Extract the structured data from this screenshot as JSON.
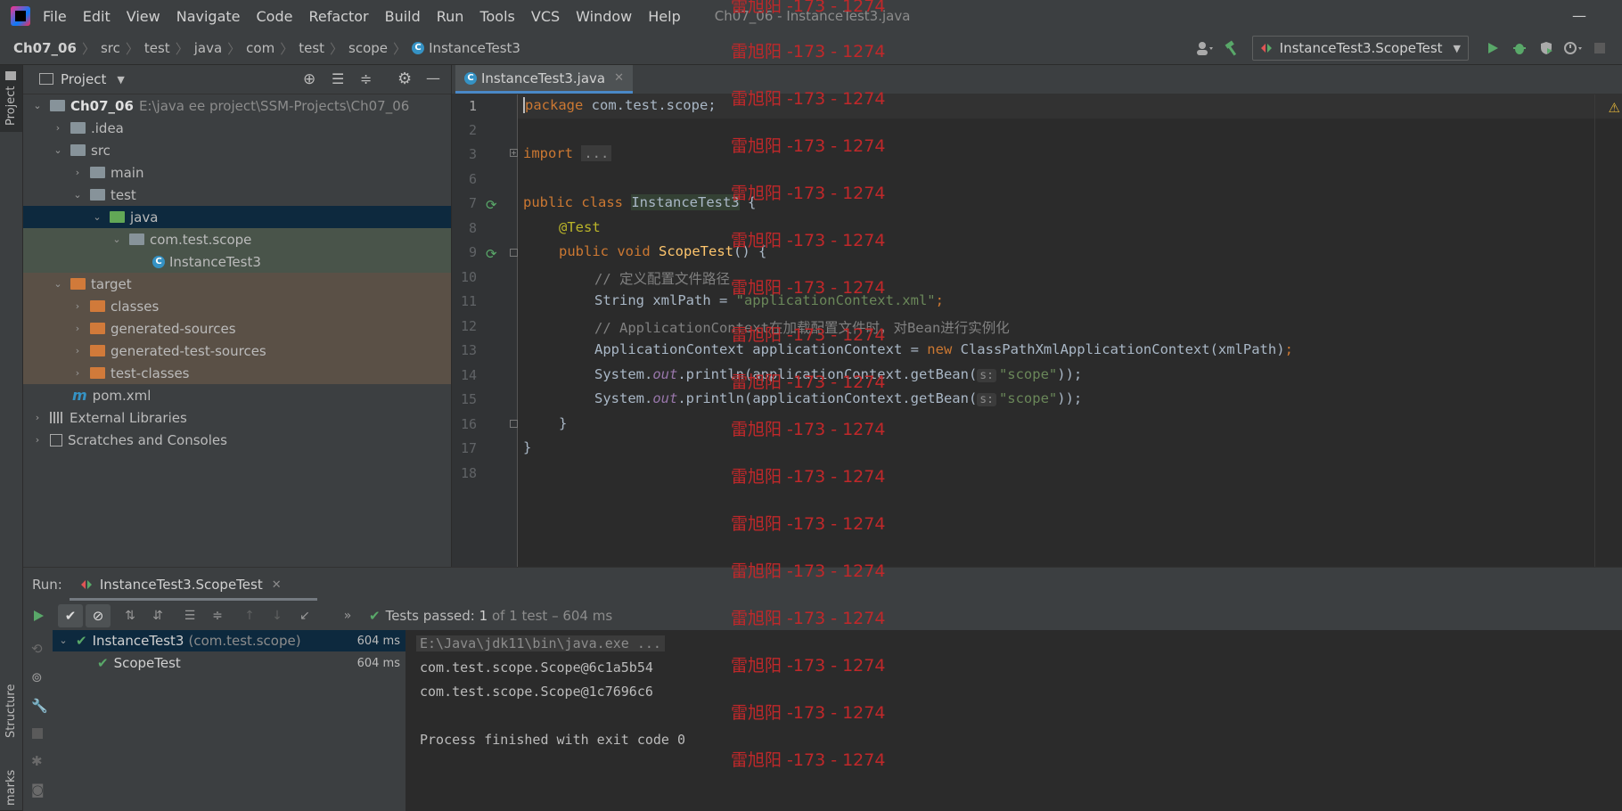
{
  "window": {
    "title": "Ch07_06 - InstanceTest3.java",
    "minimize_glyph": "—"
  },
  "menu": [
    "File",
    "Edit",
    "View",
    "Navigate",
    "Code",
    "Refactor",
    "Build",
    "Run",
    "Tools",
    "VCS",
    "Window",
    "Help"
  ],
  "breadcrumb": [
    "Ch07_06",
    "src",
    "test",
    "java",
    "com",
    "test",
    "scope",
    "InstanceTest3"
  ],
  "toolbar": {
    "run_config": "InstanceTest3.ScopeTest"
  },
  "stripe": {
    "project": "Project",
    "structure": "Structure",
    "bookmarks": "marks"
  },
  "project_panel": {
    "title": "Project",
    "tree": [
      {
        "label": "Ch07_06",
        "path": "E:\\java ee project\\SSM-Projects\\Ch07_06"
      },
      {
        "label": ".idea"
      },
      {
        "label": "src"
      },
      {
        "label": "main"
      },
      {
        "label": "test"
      },
      {
        "label": "java"
      },
      {
        "label": "com.test.scope"
      },
      {
        "label": "InstanceTest3"
      },
      {
        "label": "target"
      },
      {
        "label": "classes"
      },
      {
        "label": "generated-sources"
      },
      {
        "label": "generated-test-sources"
      },
      {
        "label": "test-classes"
      },
      {
        "label": "pom.xml"
      },
      {
        "label": "External Libraries"
      },
      {
        "label": "Scratches and Consoles"
      }
    ]
  },
  "editor": {
    "tab": "InstanceTest3.java",
    "line_numbers": [
      "1",
      "2",
      "3",
      "6",
      "7",
      "8",
      "9",
      "10",
      "11",
      "12",
      "13",
      "14",
      "15",
      "16",
      "17",
      "18"
    ],
    "code": {
      "l1_kw": "package",
      "l1_rest": " com.test.scope;",
      "l3_kw": "import",
      "l3_fold": "...",
      "l7_kw": "public class",
      "l7_cls": "InstanceTest3",
      "l7_rest": " {",
      "l8_ann": "@Test",
      "l9_kw": "public void",
      "l9_fn": "ScopeTest",
      "l9_rest": "() {",
      "l10_cmt": "// 定义配置文件路径",
      "l11_a": "String xmlPath = ",
      "l11_str": "\"applicationContext.xml\"",
      "l11_end": ";",
      "l12_cmt": "// ApplicationContext在加载配置文件时，对Bean进行实例化",
      "l13_a": "ApplicationContext applicationContext = ",
      "l13_kw": "new",
      "l13_b": " ClassPathXmlApplicationContext(xmlPath)",
      "l13_end": ";",
      "l14_a": "System.",
      "l14_fld": "out",
      "l14_b": ".println(applicationContext.getBean(",
      "l14_hint": "s:",
      "l14_str": "\"scope\"",
      "l14_end": "));",
      "l15_a": "System.",
      "l15_fld": "out",
      "l15_b": ".println(applicationContext.getBean(",
      "l15_hint": "s:",
      "l15_str": "\"scope\"",
      "l15_end": "));",
      "l16": "}",
      "l17": "}"
    }
  },
  "run_panel": {
    "label": "Run:",
    "tab": "InstanceTest3.ScopeTest",
    "status_prefix": "Tests passed:",
    "status_count": "1",
    "status_suffix": "of 1 test – 604 ms",
    "tests": [
      {
        "name": "InstanceTest3",
        "pkg": "(com.test.scope)",
        "time": "604 ms"
      },
      {
        "name": "ScopeTest",
        "time": "604 ms"
      }
    ],
    "console": [
      "E:\\Java\\jdk11\\bin\\java.exe ...",
      "com.test.scope.Scope@6c1a5b54",
      "com.test.scope.Scope@1c7696c6",
      "",
      "Process finished with exit code 0"
    ]
  },
  "watermark": "雷旭阳 -173 - 1274",
  "colors": {
    "accent": "#4a88c7",
    "pass": "#59a869",
    "watermark": "#c0282a"
  }
}
